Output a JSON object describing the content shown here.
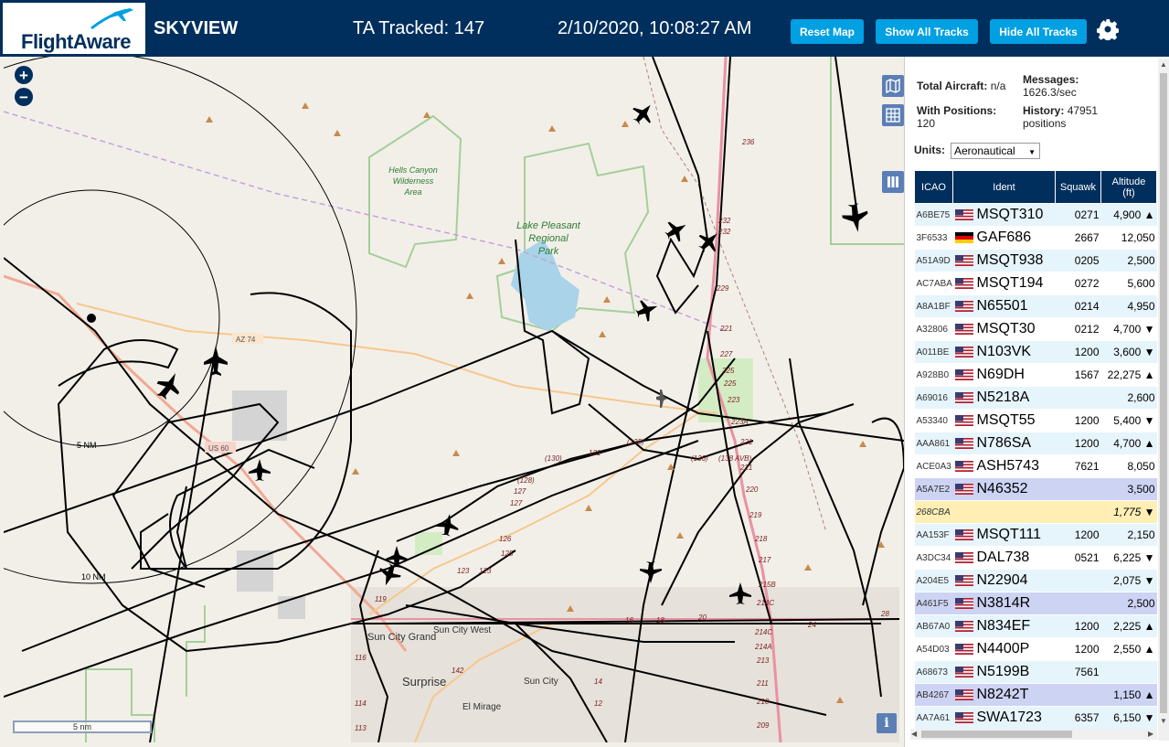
{
  "header": {
    "logo": "FlightAware",
    "app_title": "SKYVIEW",
    "tracked": "TA Tracked: 147",
    "clock": "2/10/2020, 10:08:27 AM",
    "buttons": {
      "reset": "Reset Map",
      "show": "Show All Tracks",
      "hide": "Hide All Tracks"
    }
  },
  "map": {
    "zoom_in": "+",
    "zoom_out": "−",
    "scale": "5 nm",
    "info": "i",
    "ring_labels": [
      "5 NM",
      "10 NM"
    ],
    "places": {
      "hells_canyon": [
        "Hells Canyon",
        "Wilderness",
        "Area"
      ],
      "lake_pleasant": [
        "Lake Pleasant",
        "Regional",
        "Park"
      ],
      "sun_city_grand": "Sun City Grand",
      "sun_city_west": "Sun City West",
      "surprise": "Surprise",
      "sun_city": "Sun City",
      "el_mirage": "El Mirage"
    },
    "roads": {
      "az74": "AZ 74",
      "us60": "US 60",
      "r229": "229",
      "r227": "227",
      "r225": "225",
      "r223": "223",
      "r223a": "223A",
      "r221a": "221",
      "r221b": "221",
      "r220": "220",
      "r219": "219",
      "r218": "218",
      "r217": "217",
      "r215b": "215B",
      "r214c": "214C",
      "r214a": "214A",
      "r213": "213",
      "r211": "211",
      "r210": "210",
      "r209": "209",
      "r232a": "232",
      "r232b": "232",
      "r236": "236",
      "r131": "131",
      "r130": "(130)",
      "r135": "(135)",
      "r136": "(136)",
      "r138": "(138 AVB)",
      "r128": "(128)",
      "r127": "127",
      "r126": "126",
      "r125": "125",
      "r123": "123",
      "r119": "119",
      "r116": "116",
      "r114": "114",
      "r113": "113",
      "r142": "142",
      "r14": "14",
      "r12": "12",
      "r28": "28",
      "r24": "24",
      "r20": "20",
      "r18": "18",
      "r16": "16"
    }
  },
  "stats": {
    "total_label": "Total Aircraft:",
    "total_value": "n/a",
    "messages_label": "Messages:",
    "messages_value": "1626.3/sec",
    "positions_label": "With Positions:",
    "positions_value": "120",
    "history_label": "History:",
    "history_value": "47951",
    "history_unit": "positions"
  },
  "units": {
    "label": "Units:",
    "value": "Aeronautical"
  },
  "table": {
    "headers": {
      "icao": "ICAO",
      "ident": "Ident",
      "squawk": "Squawk",
      "alt1": "Altitude",
      "alt2": "(ft)"
    },
    "rows": [
      {
        "icao": "A6BE75",
        "ident": "MSQT310",
        "squawk": "0271",
        "alt": "4,900 ▲",
        "flag": "us"
      },
      {
        "icao": "3F6533",
        "ident": "GAF686",
        "squawk": "2667",
        "alt": "12,050",
        "flag": "de"
      },
      {
        "icao": "A51A9D",
        "ident": "MSQT938",
        "squawk": "0205",
        "alt": "2,500",
        "flag": "us"
      },
      {
        "icao": "AC7ABA",
        "ident": "MSQT194",
        "squawk": "0272",
        "alt": "5,600",
        "flag": "us"
      },
      {
        "icao": "A8A1BF",
        "ident": "N65501",
        "squawk": "0214",
        "alt": "4,950",
        "flag": "us"
      },
      {
        "icao": "A32806",
        "ident": "MSQT30",
        "squawk": "0212",
        "alt": "4,700 ▼",
        "flag": "us"
      },
      {
        "icao": "A011BE",
        "ident": "N103VK",
        "squawk": "1200",
        "alt": "3,600 ▼",
        "flag": "us"
      },
      {
        "icao": "A928B0",
        "ident": "N69DH",
        "squawk": "1567",
        "alt": "22,275 ▲",
        "flag": "us"
      },
      {
        "icao": "A69016",
        "ident": "N5218A",
        "squawk": "",
        "alt": "2,600",
        "flag": "us"
      },
      {
        "icao": "A53340",
        "ident": "MSQT55",
        "squawk": "1200",
        "alt": "5,400 ▼",
        "flag": "us"
      },
      {
        "icao": "AAA861",
        "ident": "N786SA",
        "squawk": "1200",
        "alt": "4,700 ▲",
        "flag": "us"
      },
      {
        "icao": "ACE0A3",
        "ident": "ASH5743",
        "squawk": "7621",
        "alt": "8,050",
        "flag": "us"
      },
      {
        "icao": "A5A7E2",
        "ident": "N46352",
        "squawk": "",
        "alt": "3,500",
        "flag": "us"
      },
      {
        "icao": "268CBA",
        "ident": "",
        "squawk": "",
        "alt": "1,775 ▼",
        "flag": ""
      },
      {
        "icao": "AA153F",
        "ident": "MSQT111",
        "squawk": "1200",
        "alt": "2,150",
        "flag": "us"
      },
      {
        "icao": "A3DC34",
        "ident": "DAL738",
        "squawk": "0521",
        "alt": "6,225 ▼",
        "flag": "us"
      },
      {
        "icao": "A204E5",
        "ident": "N22904",
        "squawk": "",
        "alt": "2,075 ▼",
        "flag": "us"
      },
      {
        "icao": "A461F5",
        "ident": "N3814R",
        "squawk": "",
        "alt": "2,500",
        "flag": "us"
      },
      {
        "icao": "AB67A0",
        "ident": "N834EF",
        "squawk": "1200",
        "alt": "2,225 ▲",
        "flag": "us"
      },
      {
        "icao": "A54D03",
        "ident": "N4400P",
        "squawk": "1200",
        "alt": "2,550 ▲",
        "flag": "us"
      },
      {
        "icao": "A68673",
        "ident": "N5199B",
        "squawk": "7561",
        "alt": "",
        "flag": "us"
      },
      {
        "icao": "AB4267",
        "ident": "N8242T",
        "squawk": "",
        "alt": "1,150 ▲",
        "flag": "us"
      },
      {
        "icao": "AA7A61",
        "ident": "SWA1723",
        "squawk": "6357",
        "alt": "6,150 ▼",
        "flag": "us"
      }
    ]
  },
  "colors": {
    "brand": "#002f5d",
    "button": "#00a0e2",
    "row_alt": "#e6f4fc",
    "row_selected": "#cdd3f3",
    "row_highlight": "#ffefb5"
  }
}
